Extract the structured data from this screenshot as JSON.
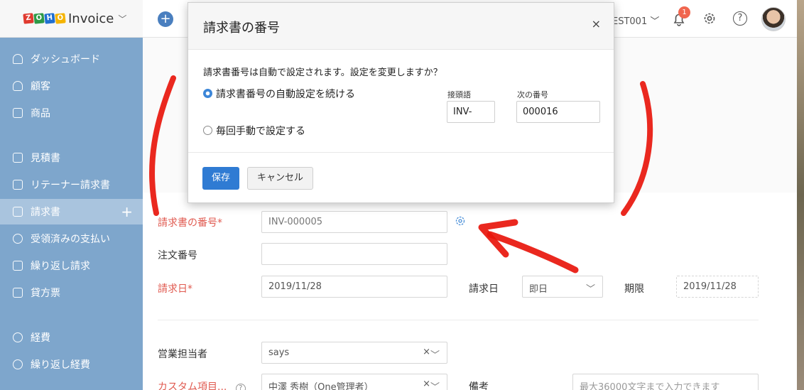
{
  "app": {
    "logo_letters": [
      "Z",
      "O",
      "H",
      "O"
    ],
    "logo_colors": [
      "#e03a2f",
      "#2d9a46",
      "#1f6fd1",
      "#f5b400"
    ],
    "name": "Invoice",
    "org_name": "EST001",
    "notification_count": "1"
  },
  "sidebar": {
    "items": [
      {
        "label": "ダッシュボード",
        "icon": "dashboard-icon"
      },
      {
        "label": "顧客",
        "icon": "user-icon"
      },
      {
        "label": "商品",
        "icon": "basket-icon"
      },
      {
        "label": "見積書",
        "icon": "estimate-icon"
      },
      {
        "label": "リテーナー請求書",
        "icon": "retainer-icon"
      },
      {
        "label": "請求書",
        "icon": "invoice-icon",
        "active": true
      },
      {
        "label": "受領済みの支払い",
        "icon": "payment-icon"
      },
      {
        "label": "繰り返し請求",
        "icon": "recurring-icon"
      },
      {
        "label": "貸方票",
        "icon": "credit-note-icon"
      },
      {
        "label": "経費",
        "icon": "expense-icon"
      },
      {
        "label": "繰り返し経費",
        "icon": "recurring-expense-icon"
      }
    ],
    "add_symbol": "+"
  },
  "form": {
    "invoice_number_label": "請求書の番号*",
    "invoice_number_value": "INV-000005",
    "order_number_label": "注文番号",
    "order_number_value": "",
    "invoice_date_label": "請求日*",
    "invoice_date_value": "2019/11/28",
    "terms_label": "請求日",
    "terms_value": "即日",
    "due_label": "期限",
    "due_value": "2019/11/28",
    "salesperson_label": "営業担当者",
    "salesperson_value": "says",
    "custom_label": "カスタム項目...",
    "custom_help": "?",
    "custom_value": "中澤 秀樹（One管理者）",
    "notes_label": "備考",
    "notes_placeholder": "最大36000文字まで入力できます"
  },
  "modal": {
    "title": "請求書の番号",
    "close": "×",
    "question": "請求書番号は自動で設定されます。設定を変更しますか？",
    "option_auto": "請求書番号の自動設定を続ける",
    "option_manual": "毎回手動で設定する",
    "prefix_label": "接頭語",
    "prefix_value": "INV-",
    "next_label": "次の番号",
    "next_value": "000016",
    "save_label": "保存",
    "cancel_label": "キャンセル"
  },
  "colors": {
    "sidebar_bg": "#7ea6cc",
    "primary": "#2f7bd3",
    "required": "#e05a50",
    "annotation": "#e8160c"
  }
}
